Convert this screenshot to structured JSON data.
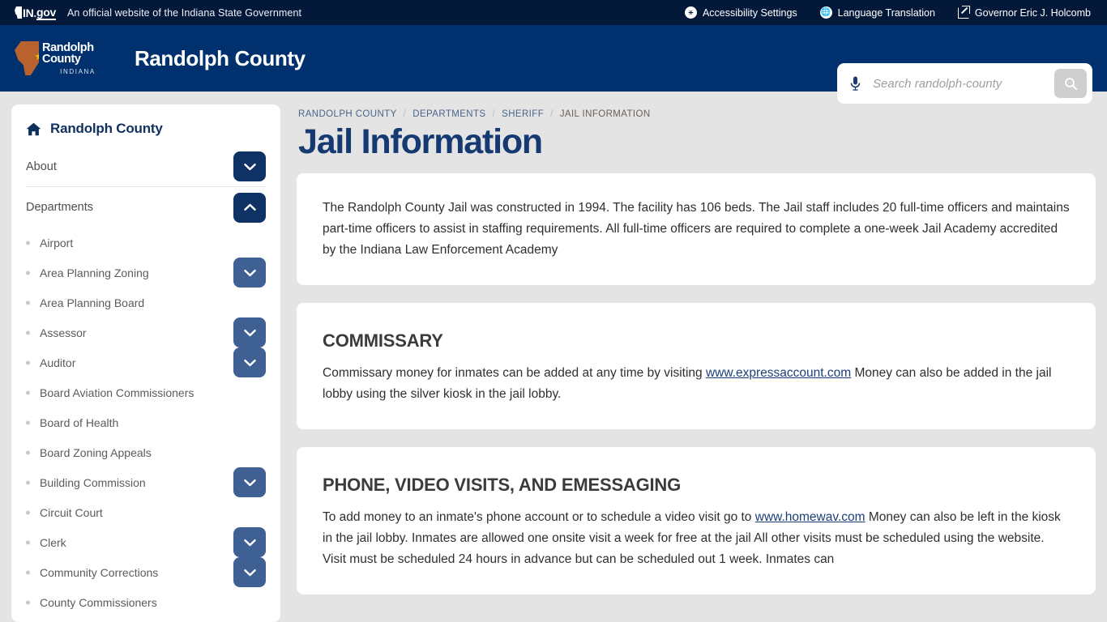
{
  "topbar": {
    "logo_in": "IN",
    "logo_dot": ".",
    "logo_gov": "gov",
    "official_text": "An official website of the Indiana State Government",
    "links": [
      {
        "label": "Accessibility Settings",
        "icon": "accessibility-icon"
      },
      {
        "label": "Language Translation",
        "icon": "globe-icon"
      },
      {
        "label": "Governor Eric J. Holcomb",
        "icon": "external-link-icon"
      }
    ]
  },
  "header": {
    "seal_name": "Randolph County",
    "seal_state": "INDIANA",
    "site_title": "Randolph County",
    "search": {
      "placeholder": "Search randolph-county",
      "value": "",
      "mic_icon": "microphone-icon",
      "search_icon": "search-icon"
    }
  },
  "sidebar": {
    "home_label": "Randolph County",
    "home_icon": "home-icon",
    "top_items": [
      {
        "label": "About",
        "toggle": "chevron-down-icon",
        "expanded": false
      },
      {
        "label": "Departments",
        "toggle": "chevron-up-icon",
        "expanded": true
      }
    ],
    "sub_items": [
      {
        "label": "Airport",
        "toggle": null
      },
      {
        "label": "Area Planning Zoning",
        "toggle": "chevron-down-icon"
      },
      {
        "label": "Area Planning Board",
        "toggle": null
      },
      {
        "label": "Assessor",
        "toggle": "chevron-down-icon"
      },
      {
        "label": "Auditor",
        "toggle": "chevron-down-icon"
      },
      {
        "label": "Board Aviation Commissioners",
        "toggle": null
      },
      {
        "label": "Board of Health",
        "toggle": null
      },
      {
        "label": "Board Zoning Appeals",
        "toggle": null
      },
      {
        "label": "Building Commission",
        "toggle": "chevron-down-icon"
      },
      {
        "label": "Circuit Court",
        "toggle": null
      },
      {
        "label": "Clerk",
        "toggle": "chevron-down-icon"
      },
      {
        "label": "Community Corrections",
        "toggle": "chevron-down-icon"
      },
      {
        "label": "County Commissioners",
        "toggle": null
      }
    ]
  },
  "main": {
    "breadcrumb": [
      {
        "label": "RANDOLPH COUNTY",
        "current": false
      },
      {
        "label": "DEPARTMENTS",
        "current": false
      },
      {
        "label": "SHERIFF",
        "current": false
      },
      {
        "label": "JAIL INFORMATION",
        "current": true
      }
    ],
    "breadcrumb_separator": "/",
    "page_title": "Jail Information",
    "cards": [
      {
        "heading": null,
        "paragraphs": [
          {
            "parts": [
              {
                "text": "The Randolph County Jail was constructed in 1994. The facility has 106 beds. The Jail staff includes 20 full-time officers and maintains part-time officers to assist in staffing requirements.  All full-time officers are required to complete a one-week Jail Academy accredited by the Indiana Law Enforcement Academy",
                "link": false
              }
            ]
          }
        ]
      },
      {
        "heading": "COMMISSARY",
        "paragraphs": [
          {
            "parts": [
              {
                "text": "Commissary money for inmates can be added at any time by visiting  ",
                "link": false
              },
              {
                "text": "www.expressaccount.com",
                "link": true
              },
              {
                "text": " Money can also be added in the jail lobby using the silver kiosk in the jail lobby.",
                "link": false
              }
            ]
          }
        ]
      },
      {
        "heading": "PHONE, VIDEO VISITS,  AND EMESSAGING",
        "paragraphs": [
          {
            "parts": [
              {
                "text": "To add money to an inmate's phone account or to schedule a video visit go to ",
                "link": false
              },
              {
                "text": "www.homewav.com",
                "link": true
              },
              {
                "text": "  Money can also be left in the kiosk in the jail lobby.  Inmates are allowed one onsite visit a week for free at the jail  All other visits must be scheduled using the website.  Visit must be scheduled 24 hours in advance but can be scheduled out 1 week.  Inmates can",
                "link": false
              }
            ]
          }
        ]
      }
    ]
  },
  "colors": {
    "topbar_bg": "#04193a",
    "header_bg": "#00306e",
    "page_bg": "#e4e4e4",
    "title_navy": "#153a72",
    "toggle_primary": "#0e3263",
    "toggle_secondary": "#3f6092",
    "link": "#1a3f78",
    "seal_orange": "#b8622f",
    "seal_star": "#f5c518"
  }
}
